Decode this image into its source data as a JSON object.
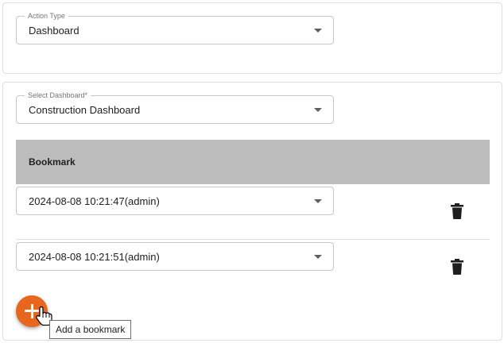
{
  "action_type": {
    "label": "Action Type",
    "value": "Dashboard"
  },
  "select_dashboard": {
    "label": "Select Dashboard*",
    "value": "Construction Dashboard"
  },
  "bookmarks": {
    "header": "Bookmark",
    "items": [
      {
        "value": "2024-08-08 10:21:47(admin)"
      },
      {
        "value": "2024-08-08 10:21:51(admin)"
      }
    ]
  },
  "add_button": {
    "tooltip": "Add a bookmark"
  },
  "colors": {
    "fab": "#e8671e",
    "header_bg": "#bdbdbd"
  },
  "icons": {
    "delete": "trash-icon",
    "add": "plus-icon",
    "dropdown": "chevron-down-icon"
  }
}
